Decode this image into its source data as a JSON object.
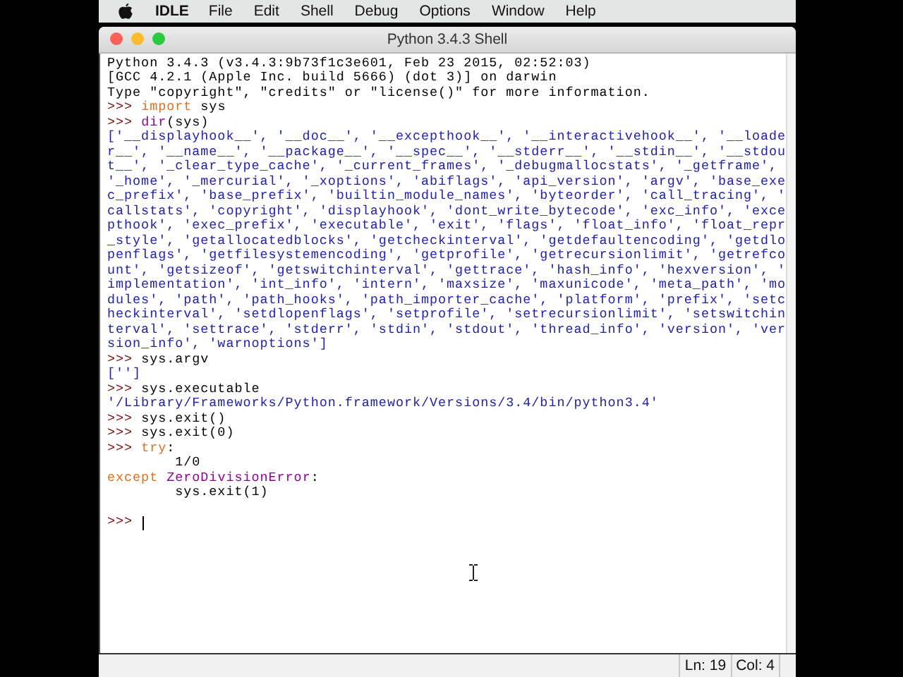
{
  "menu_bar": {
    "app_name": "IDLE",
    "items": [
      "File",
      "Edit",
      "Shell",
      "Debug",
      "Options",
      "Window",
      "Help"
    ]
  },
  "window": {
    "title": "Python 3.4.3 Shell"
  },
  "shell": {
    "lines": [
      [
        {
          "kind": "output",
          "text": "Python 3.4.3 (v3.4.3:9b73f1c3e601, Feb 23 2015, 02:52:03)"
        }
      ],
      [
        {
          "kind": "output",
          "text": "[GCC 4.2.1 (Apple Inc. build 5666) (dot 3)] on darwin"
        }
      ],
      [
        {
          "kind": "output",
          "text": "Type \"copyright\", \"credits\" or \"license()\" for more information."
        }
      ],
      [
        {
          "kind": "prompt",
          "text": ">>> "
        },
        {
          "kind": "keyword",
          "text": "import"
        },
        {
          "kind": "code",
          "text": " sys"
        }
      ],
      [
        {
          "kind": "prompt",
          "text": ">>> "
        },
        {
          "kind": "builtin",
          "text": "dir"
        },
        {
          "kind": "code",
          "text": "(sys)"
        }
      ],
      [
        {
          "kind": "result",
          "text": "['__displayhook__', '__doc__', '__excepthook__', '__interactivehook__', '__loade"
        }
      ],
      [
        {
          "kind": "result",
          "text": "r__', '__name__', '__package__', '__spec__', '__stderr__', '__stdin__', '__stdou"
        }
      ],
      [
        {
          "kind": "result",
          "text": "t__', '_clear_type_cache', '_current_frames', '_debugmallocstats', '_getframe',"
        }
      ],
      [
        {
          "kind": "result",
          "text": "'_home', '_mercurial', '_xoptions', 'abiflags', 'api_version', 'argv', 'base_exe"
        }
      ],
      [
        {
          "kind": "result",
          "text": "c_prefix', 'base_prefix', 'builtin_module_names', 'byteorder', 'call_tracing', '"
        }
      ],
      [
        {
          "kind": "result",
          "text": "callstats', 'copyright', 'displayhook', 'dont_write_bytecode', 'exc_info', 'exce"
        }
      ],
      [
        {
          "kind": "result",
          "text": "pthook', 'exec_prefix', 'executable', 'exit', 'flags', 'float_info', 'float_repr"
        }
      ],
      [
        {
          "kind": "result",
          "text": "_style', 'getallocatedblocks', 'getcheckinterval', 'getdefaultencoding', 'getdlo"
        }
      ],
      [
        {
          "kind": "result",
          "text": "penflags', 'getfilesystemencoding', 'getprofile', 'getrecursionlimit', 'getrefco"
        }
      ],
      [
        {
          "kind": "result",
          "text": "unt', 'getsizeof', 'getswitchinterval', 'gettrace', 'hash_info', 'hexversion', '"
        }
      ],
      [
        {
          "kind": "result",
          "text": "implementation', 'int_info', 'intern', 'maxsize', 'maxunicode', 'meta_path', 'mo"
        }
      ],
      [
        {
          "kind": "result",
          "text": "dules', 'path', 'path_hooks', 'path_importer_cache', 'platform', 'prefix', 'setc"
        }
      ],
      [
        {
          "kind": "result",
          "text": "heckinterval', 'setdlopenflags', 'setprofile', 'setrecursionlimit', 'setswitchin"
        }
      ],
      [
        {
          "kind": "result",
          "text": "terval', 'settrace', 'stderr', 'stdin', 'stdout', 'thread_info', 'version', 'ver"
        }
      ],
      [
        {
          "kind": "result",
          "text": "sion_info', 'warnoptions']"
        }
      ],
      [
        {
          "kind": "prompt",
          "text": ">>> "
        },
        {
          "kind": "code",
          "text": "sys.argv"
        }
      ],
      [
        {
          "kind": "result",
          "text": "['']"
        }
      ],
      [
        {
          "kind": "prompt",
          "text": ">>> "
        },
        {
          "kind": "code",
          "text": "sys.executable"
        }
      ],
      [
        {
          "kind": "result",
          "text": "'/Library/Frameworks/Python.framework/Versions/3.4/bin/python3.4'"
        }
      ],
      [
        {
          "kind": "prompt",
          "text": ">>> "
        },
        {
          "kind": "code",
          "text": "sys.exit()"
        }
      ],
      [
        {
          "kind": "prompt",
          "text": ">>> "
        },
        {
          "kind": "code",
          "text": "sys.exit(0)"
        }
      ],
      [
        {
          "kind": "prompt",
          "text": ">>> "
        },
        {
          "kind": "keyword",
          "text": "try"
        },
        {
          "kind": "code",
          "text": ":"
        }
      ],
      [
        {
          "kind": "code",
          "text": "        1/0"
        }
      ],
      [
        {
          "kind": "keyword",
          "text": "except"
        },
        {
          "kind": "builtin",
          "text": " ZeroDivisionError"
        },
        {
          "kind": "code",
          "text": ":"
        }
      ],
      [
        {
          "kind": "code",
          "text": "        sys.exit(1)"
        }
      ],
      [
        {
          "kind": "prompt",
          "text": ">>> "
        }
      ]
    ]
  },
  "status_bar": {
    "line": "Ln: 19",
    "column": "Col: 4"
  }
}
